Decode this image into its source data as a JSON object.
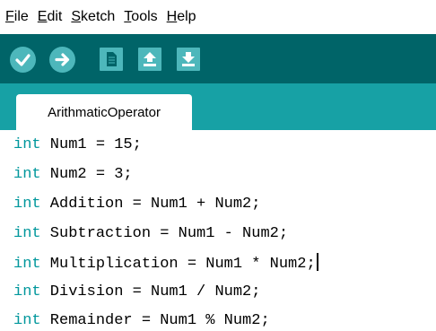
{
  "menu": [
    {
      "mnemonic": "F",
      "rest": "ile"
    },
    {
      "mnemonic": "E",
      "rest": "dit"
    },
    {
      "mnemonic": "S",
      "rest": "ketch"
    },
    {
      "mnemonic": "T",
      "rest": "ools"
    },
    {
      "mnemonic": "H",
      "rest": "elp"
    }
  ],
  "toolbar": {
    "buttons": [
      "verify-icon",
      "upload-icon",
      "new-icon",
      "open-icon",
      "save-icon"
    ],
    "colors": {
      "bg": "#006468",
      "button": "#4db7bb"
    }
  },
  "tab": {
    "label": "ArithmaticOperator"
  },
  "code": {
    "keyword": "int",
    "lines": [
      " Num1 = 15;",
      " Num2 = 3;",
      " Addition = Num1 + Num2;",
      " Subtraction = Num1 - Num2;",
      " Multiplication = Num1 * Num2;",
      " Division = Num1 / Num2;",
      " Remainder = Num1 % Num2;"
    ]
  },
  "colors": {
    "tabbar": "#17a1a5",
    "keyword": "#00979c"
  }
}
